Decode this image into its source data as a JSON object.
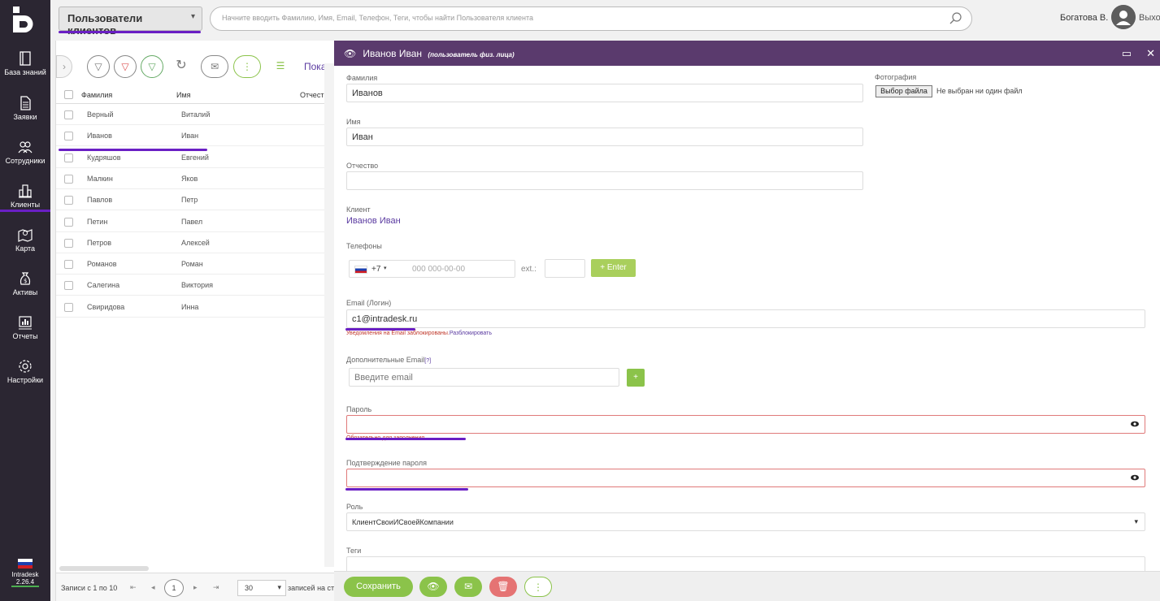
{
  "nav": {
    "items": [
      {
        "label": "База знаний",
        "icon": "book-icon"
      },
      {
        "label": "Заявки",
        "icon": "document-icon"
      },
      {
        "label": "Сотрудники",
        "icon": "people-icon"
      },
      {
        "label": "Клиенты",
        "icon": "building-icon"
      },
      {
        "label": "Карта",
        "icon": "map-icon"
      },
      {
        "label": "Активы",
        "icon": "money-bag-icon"
      },
      {
        "label": "Отчеты",
        "icon": "report-icon"
      },
      {
        "label": "Настройки",
        "icon": "gear-icon"
      }
    ],
    "app_name": "Intradesk",
    "version": "2.26.4"
  },
  "header": {
    "section": "Пользователи клиентов",
    "search_placeholder": "Начните вводить Фамилию, Имя, Email, Телефон, Теги, чтобы найти Пользователя клиента",
    "user": "Богатова В.",
    "exit": "Выход"
  },
  "list": {
    "show_label": "Показа",
    "columns": [
      "Фамилия",
      "Имя",
      "Отчест"
    ],
    "rows": [
      {
        "last": "Верный",
        "first": "Виталий"
      },
      {
        "last": "Иванов",
        "first": "Иван"
      },
      {
        "last": "Кудряшов",
        "first": "Евгений"
      },
      {
        "last": "Малкин",
        "first": "Яков"
      },
      {
        "last": "Павлов",
        "first": "Петр"
      },
      {
        "last": "Петин",
        "first": "Павел"
      },
      {
        "last": "Петров",
        "first": "Алексей"
      },
      {
        "last": "Романов",
        "first": "Роман"
      },
      {
        "last": "Салегина",
        "first": "Виктория"
      },
      {
        "last": "Свиридова",
        "first": "Инна"
      }
    ],
    "pager": {
      "records": "Записи с 1 по 10",
      "page": "1",
      "per_page": "30",
      "per_page_label": "записей на ст"
    }
  },
  "modal": {
    "title": "Иванов Иван",
    "subtitle": "(пользователь физ. лица)",
    "fields": {
      "last_name_label": "Фамилия",
      "last_name": "Иванов",
      "first_name_label": "Имя",
      "first_name": "Иван",
      "middle_name_label": "Отчество",
      "middle_name": "",
      "client_label": "Клиент",
      "client": "Иванов Иван",
      "phones_label": "Телефоны",
      "phone_code": "+7",
      "phone_placeholder": "000 000-00-00",
      "ext_label": "ext.:",
      "enter_button": "+ Enter",
      "email_label": "Email (Логин)",
      "email": "c1@intradesk.ru",
      "email_notice": "Уведомления на Email заблокированы.",
      "email_unblock": "Разблокировать",
      "extra_email_label": "Дополнительные Email",
      "extra_email_help": "[?]",
      "extra_email_placeholder": "Введите email",
      "password_label": "Пароль",
      "password_error": "Обязательно для заполнения",
      "confirm_label": "Подтверждение пароля",
      "role_label": "Роль",
      "role": "КлиентСвоиИСвоейКомпании",
      "tags_label": "Теги",
      "photo_label": "Фотография",
      "file_button": "Выбор файла",
      "file_none": "Не выбран ни один файл"
    },
    "save_button": "Сохранить"
  },
  "colors": {
    "accent": "#6a1fc4",
    "header": "#5a3a6d",
    "nav_bg": "#2b2632",
    "green": "#8bc34a",
    "red": "#e57373"
  }
}
